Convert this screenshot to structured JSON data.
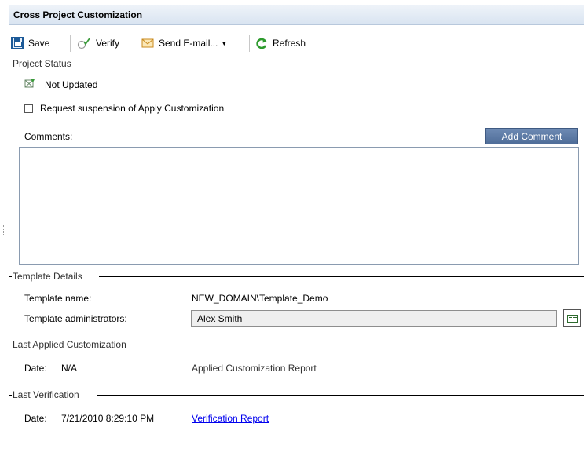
{
  "window": {
    "title": "Cross Project Customization"
  },
  "toolbar": {
    "save_label": "Save",
    "verify_label": "Verify",
    "send_email_label": "Send E-mail...",
    "refresh_label": "Refresh"
  },
  "project_status": {
    "header": "Project Status",
    "status_text": "Not Updated",
    "request_suspension_label": "Request suspension of Apply Customization",
    "request_suspension_checked": false,
    "comments_label": "Comments:",
    "add_comment_label": "Add Comment",
    "comments_value": ""
  },
  "template_details": {
    "header": "Template Details",
    "name_label": "Template name:",
    "name_value": "NEW_DOMAIN\\Template_Demo",
    "admins_label": "Template administrators:",
    "admins_value": "Alex Smith"
  },
  "last_applied": {
    "header": "Last Applied Customization",
    "date_label": "Date:",
    "date_value": "N/A",
    "report_label": "Applied Customization Report"
  },
  "last_verification": {
    "header": "Last Verification",
    "date_label": "Date:",
    "date_value": "7/21/2010 8:29:10 PM",
    "report_label": "Verification Report"
  },
  "icons": {
    "save": "save-icon",
    "verify": "verify-icon",
    "send_email": "mail-icon",
    "refresh": "refresh-icon",
    "status": "status-flag-icon",
    "admins_picker": "select-users-icon"
  },
  "colors": {
    "title_bar": "#d9e4f1",
    "add_comment_bg": "#5a78a5",
    "link": "#0000ee",
    "refresh_green": "#2e9b2e",
    "mail_orange": "#e8a33a"
  }
}
